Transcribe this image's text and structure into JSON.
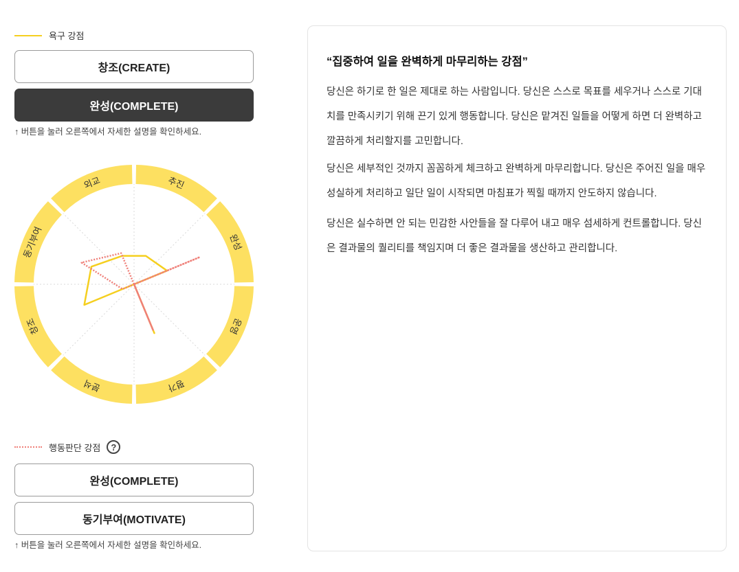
{
  "left": {
    "desire_legend": "욕구 강점",
    "desire_buttons": [
      {
        "label": "창조(CREATE)"
      },
      {
        "label": "완성(COMPLETE)"
      }
    ],
    "desire_hint": "버튼을 눌러 오른쪽에서 자세한 설명을 확인하세요.",
    "behavior_legend": "행동판단 강점",
    "help_icon_glyph": "?",
    "behavior_buttons": [
      {
        "label": "완성(COMPLETE)"
      },
      {
        "label": "동기부여(MOTIVATE)"
      }
    ],
    "behavior_hint": "버튼을 눌러 오른쪽에서 자세한 설명을 확인하세요.",
    "hint_arrow": "↑"
  },
  "chart_data": {
    "type": "radar",
    "categories": [
      "추진",
      "완성",
      "운영",
      "평가",
      "분석",
      "창조",
      "동기부여",
      "외교"
    ],
    "series": [
      {
        "name": "욕구 강점",
        "style": "solid",
        "color": "#f5cf1f",
        "values": [
          0.32,
          0.37,
          0.0,
          0.55,
          0.0,
          0.56,
          0.48,
          0.32
        ]
      },
      {
        "name": "행동판단 강점",
        "style": "dotted",
        "color": "#ef7f78",
        "values": [
          0.0,
          0.74,
          0.0,
          0.52,
          0.0,
          0.13,
          0.59,
          0.35
        ]
      }
    ],
    "ring_color": "#fde061"
  },
  "detail": {
    "title": "“집중하여 일을 완벽하게 마무리하는 강점”",
    "paragraphs": [
      "당신은 하기로 한 일은 제대로 하는 사람입니다. 당신은 스스로 목표를 세우거나 스스로 기대치를 만족시키기 위해 끈기 있게 행동합니다. 당신은 맡겨진 일들을 어떻게 하면 더 완벽하고 깔끔하게 처리할지를 고민합니다.",
      "당신은 세부적인 것까지 꼼꼼하게 체크하고 완벽하게 마무리합니다. 당신은 주어진 일을 매우 성실하게 처리하고 일단 일이 시작되면 마침표가 찍힐 때까지 안도하지 않습니다.",
      "당신은 실수하면 안 되는 민감한 사안들을 잘 다루어 내고 매우 섬세하게 컨트롤합니다. 당신은 결과물의 퀄리티를 책임지며 더 좋은 결과물을 생산하고 관리합니다."
    ]
  }
}
